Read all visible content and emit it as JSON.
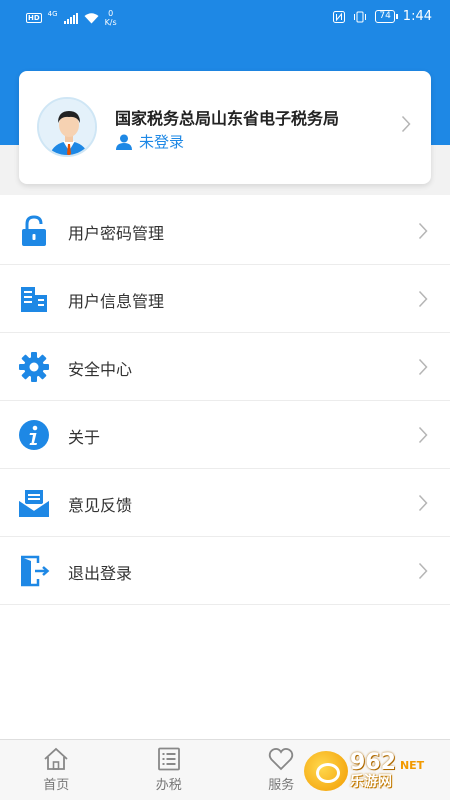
{
  "status_bar": {
    "hd": "HD",
    "network": "4G",
    "speed_value": "0",
    "speed_unit": "K/s",
    "battery": "74",
    "time": "1:44"
  },
  "profile": {
    "org_name": "国家税务总局山东省电子税务局",
    "login_status": "未登录",
    "accent_color": "#1e88e5"
  },
  "menu": {
    "items": [
      {
        "label": "用户密码管理",
        "icon": "lock-icon"
      },
      {
        "label": "用户信息管理",
        "icon": "building-id-icon"
      },
      {
        "label": "安全中心",
        "icon": "gear-icon"
      },
      {
        "label": "关于",
        "icon": "info-icon"
      },
      {
        "label": "意见反馈",
        "icon": "feedback-mail-icon"
      },
      {
        "label": "退出登录",
        "icon": "logout-door-icon"
      }
    ]
  },
  "bottom_nav": {
    "items": [
      {
        "label": "首页",
        "icon": "home-icon"
      },
      {
        "label": "办税",
        "icon": "tax-list-icon"
      },
      {
        "label": "服务",
        "icon": "heart-icon"
      }
    ]
  },
  "watermark": {
    "number": "962",
    "net": "NET",
    "site": "乐游网"
  }
}
